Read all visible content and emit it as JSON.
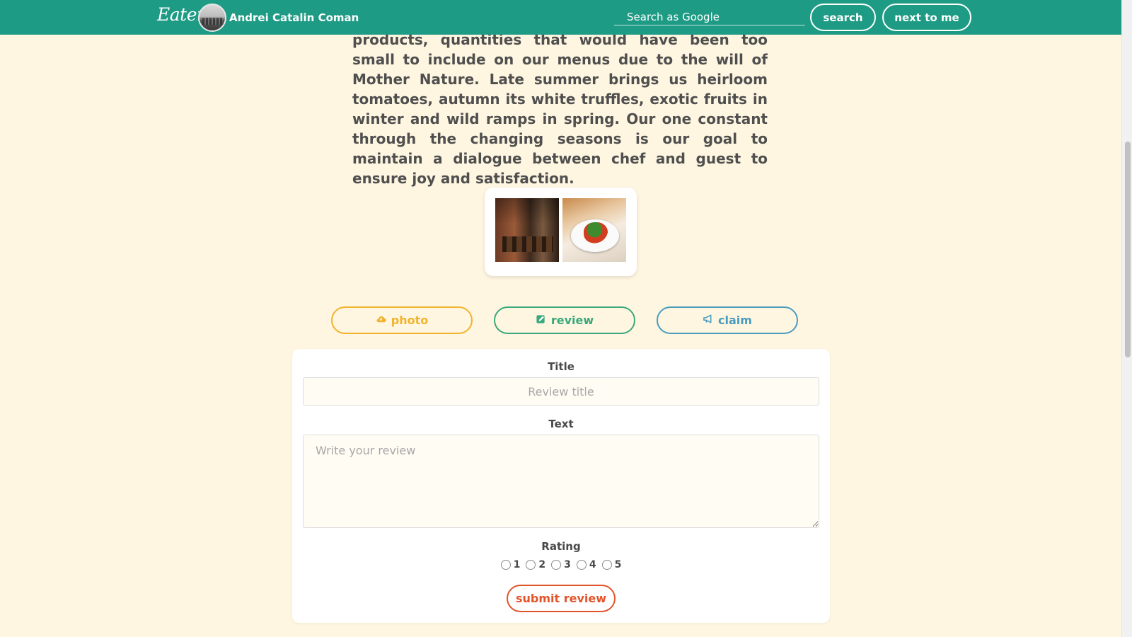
{
  "header": {
    "logo": "Eater",
    "username": "Andrei Catalin Coman",
    "search_placeholder": "Search as Google",
    "search_button": "search",
    "next_button": "next to me",
    "bg_color": "#1e9b84"
  },
  "restaurant": {
    "description": "customer's particular interests in mind, we are able to utilize smaller amounts of unique seasonal products, quantities that would have been too small to include on our menus due to the will of Mother Nature. Late summer brings us heirloom tomatoes, autumn its white truffles, exotic fruits in winter and wild ramps in spring. Our one constant through the changing seasons is our goal to maintain a dialogue between chef and guest to ensure joy and satisfaction."
  },
  "actions": {
    "photo": {
      "label": "photo",
      "icon": "cloud-upload-icon",
      "color": "#f2b32c"
    },
    "review": {
      "label": "review",
      "icon": "edit-icon",
      "color": "#3aa87b"
    },
    "claim": {
      "label": "claim",
      "icon": "bullhorn-icon",
      "color": "#4a9cbd"
    }
  },
  "review_form": {
    "title_label": "Title",
    "title_placeholder": "Review title",
    "text_label": "Text",
    "text_placeholder": "Write your review",
    "rating_label": "Rating",
    "rating_options": [
      "1",
      "2",
      "3",
      "4",
      "5"
    ],
    "submit_label": "submit review",
    "submit_color": "#e2542a"
  }
}
